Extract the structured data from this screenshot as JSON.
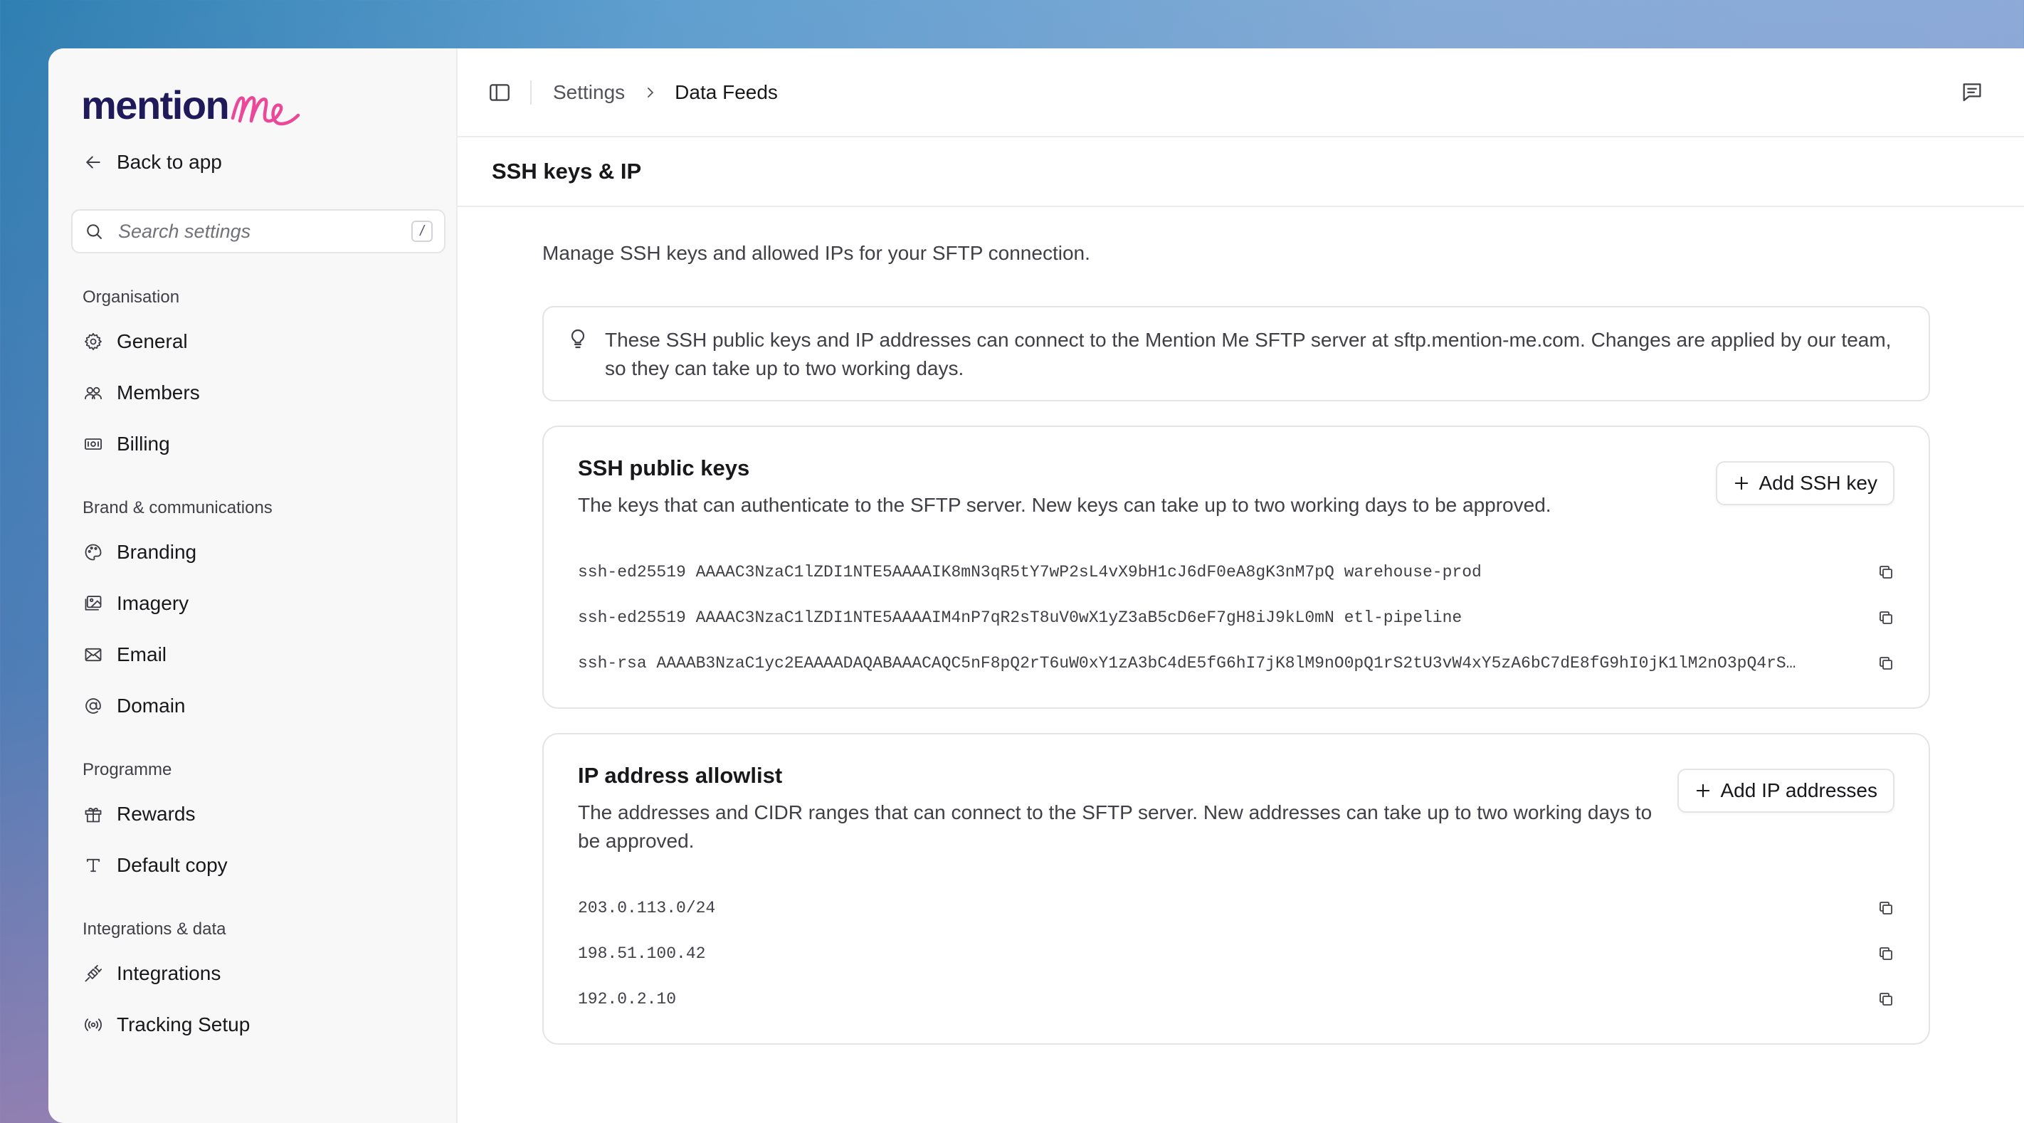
{
  "brand": {
    "logo_text": "mention",
    "logo_script": "me",
    "accent": "#ec4899",
    "navy": "#1f1b5a"
  },
  "sidebar": {
    "back_label": "Back to app",
    "search_placeholder": "Search settings",
    "search_shortcut": "/",
    "groups": [
      {
        "label": "Organisation",
        "items": [
          {
            "label": "General",
            "icon": "gear-icon"
          },
          {
            "label": "Members",
            "icon": "users-icon"
          },
          {
            "label": "Billing",
            "icon": "banknote-icon"
          }
        ]
      },
      {
        "label": "Brand & communications",
        "items": [
          {
            "label": "Branding",
            "icon": "palette-icon"
          },
          {
            "label": "Imagery",
            "icon": "images-icon"
          },
          {
            "label": "Email",
            "icon": "mail-icon"
          },
          {
            "label": "Domain",
            "icon": "at-sign-icon"
          }
        ]
      },
      {
        "label": "Programme",
        "items": [
          {
            "label": "Rewards",
            "icon": "gift-icon"
          },
          {
            "label": "Default copy",
            "icon": "type-icon"
          }
        ]
      },
      {
        "label": "Integrations & data",
        "items": [
          {
            "label": "Integrations",
            "icon": "plug-icon"
          },
          {
            "label": "Tracking Setup",
            "icon": "radio-icon"
          }
        ]
      }
    ]
  },
  "header": {
    "breadcrumb": [
      "Settings",
      "Data Feeds"
    ],
    "page_title": "SSH keys & IP"
  },
  "main": {
    "intro": "Manage SSH keys and allowed IPs for your SFTP connection.",
    "callout": "These SSH public keys and IP addresses can connect to the Mention Me SFTP server at sftp.mention-me.com. Changes are applied by our team, so they can take up to two working days.",
    "ssh": {
      "title": "SSH public keys",
      "description": "The keys that can authenticate to the SFTP server. New keys can take up to two working days to be approved.",
      "button": "Add SSH key",
      "keys": [
        "ssh-ed25519 AAAAC3NzaC1lZDI1NTE5AAAAIK8mN3qR5tY7wP2sL4vX9bH1cJ6dF0eA8gK3nM7pQ warehouse-prod",
        "ssh-ed25519 AAAAC3NzaC1lZDI1NTE5AAAAIM4nP7qR2sT8uV0wX1yZ3aB5cD6eF7gH8iJ9kL0mN etl-pipeline",
        "ssh-rsa AAAAB3NzaC1yc2EAAAADAQABAAACAQC5nF8pQ2rT6uW0xY1zA3bC4dE5fG6hI7jK8lM9nO0pQ1rS2tU3vW4xY5zA6bC7dE8fG9hI0jK1lM2nO3pQ4rS…"
      ]
    },
    "ip": {
      "title": "IP address allowlist",
      "description": "The addresses and CIDR ranges that can connect to the SFTP server. New addresses can take up to two working days to be approved.",
      "button": "Add IP addresses",
      "addresses": [
        "203.0.113.0/24",
        "198.51.100.42",
        "192.0.2.10"
      ]
    }
  }
}
